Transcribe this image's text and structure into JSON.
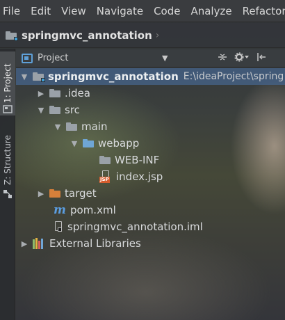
{
  "menubar": {
    "items": [
      "File",
      "Edit",
      "View",
      "Navigate",
      "Code",
      "Analyze",
      "Refactor"
    ]
  },
  "breadcrumb": {
    "project": "springmvc_annotation",
    "separator": "›"
  },
  "toolstrip": {
    "project_tab": "1: Project",
    "structure_tab": "Z: Structure"
  },
  "panel": {
    "title": "Project",
    "dropdown_arrow": "▼",
    "tool_icons": [
      "collapse-all-icon",
      "gear-icon",
      "hide-icon"
    ]
  },
  "tree": {
    "root": {
      "label": "springmvc_annotation",
      "path": "E:\\ideaProject\\spring"
    },
    "idea": "idea",
    "src": "src",
    "main": "main",
    "webapp": "webapp",
    "webinf": "WEB-INF",
    "indexjsp": "index.jsp",
    "jsp_badge": "JSP",
    "target": "target",
    "pom": "pom.xml",
    "pom_icon_letter": "m",
    "iml": "springmvc_annotation.iml",
    "external": "External Libraries"
  },
  "colors": {
    "selection": "#46648c",
    "module_folder": "#6fa6d6",
    "excluded_folder": "#d7803a",
    "maven": "#5b9de0"
  }
}
